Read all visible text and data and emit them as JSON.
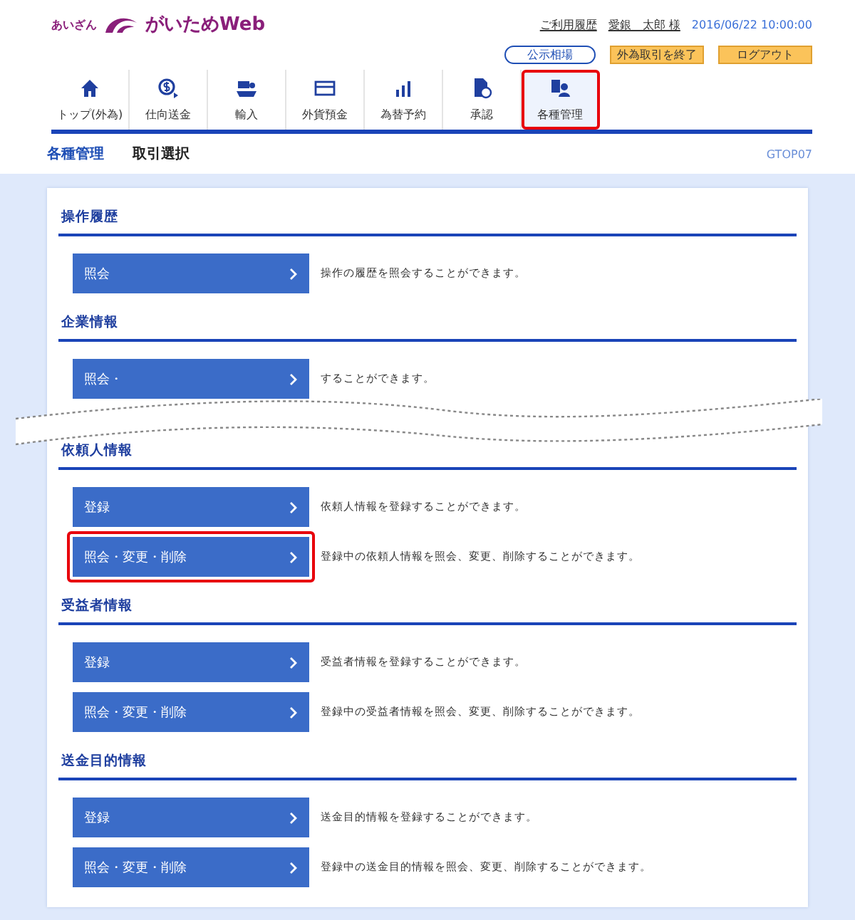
{
  "header": {
    "logo_small": "あいざん",
    "logo_main": "がいためWeb",
    "links": [
      {
        "label": "ご利用履歴"
      },
      {
        "label": "愛銀　太郎 様"
      }
    ],
    "datetime": "2016/06/22 10:00:00",
    "rate_button": "公示相場",
    "buttons": [
      {
        "label": "外為取引を終了"
      },
      {
        "label": "ログアウト"
      }
    ]
  },
  "nav": [
    {
      "label": "トップ(外為)",
      "selected": false,
      "highlighted": false
    },
    {
      "label": "仕向送金",
      "selected": false,
      "highlighted": false
    },
    {
      "label": "輸入",
      "selected": false,
      "highlighted": false
    },
    {
      "label": "外貨預金",
      "selected": false,
      "highlighted": false
    },
    {
      "label": "為替予約",
      "selected": false,
      "highlighted": false
    },
    {
      "label": "承認",
      "selected": false,
      "highlighted": false
    },
    {
      "label": "各種管理",
      "selected": true,
      "highlighted": true
    }
  ],
  "breadcrumb": {
    "section": "各種管理",
    "page": "取引選択",
    "screen_id": "GTOP07"
  },
  "sections": [
    {
      "kind": "normal",
      "title": "操作履歴",
      "rows": [
        {
          "button": "照会",
          "description": "操作の履歴を照会することができます。",
          "highlighted": false
        }
      ]
    },
    {
      "kind": "torn",
      "title": "企業情報",
      "rows": [
        {
          "button": "照会・",
          "description": "することができます。",
          "highlighted": false
        }
      ]
    },
    {
      "kind": "normal",
      "title": "依頼人情報",
      "rows": [
        {
          "button": "登録",
          "description": "依頼人情報を登録することができます。",
          "highlighted": false
        },
        {
          "button": "照会・変更・削除",
          "description": "登録中の依頼人情報を照会、変更、削除することができます。",
          "highlighted": true
        }
      ]
    },
    {
      "kind": "normal",
      "title": "受益者情報",
      "rows": [
        {
          "button": "登録",
          "description": "受益者情報を登録することができます。",
          "highlighted": false
        },
        {
          "button": "照会・変更・削除",
          "description": "登録中の受益者情報を照会、変更、削除することができます。",
          "highlighted": false
        }
      ]
    },
    {
      "kind": "normal",
      "title": "送金目的情報",
      "rows": [
        {
          "button": "登録",
          "description": "送金目的情報を登録することができます。",
          "highlighted": false
        },
        {
          "button": "照会・変更・削除",
          "description": "登録中の送金目的情報を照会、変更、削除することができます。",
          "highlighted": false
        }
      ]
    }
  ]
}
